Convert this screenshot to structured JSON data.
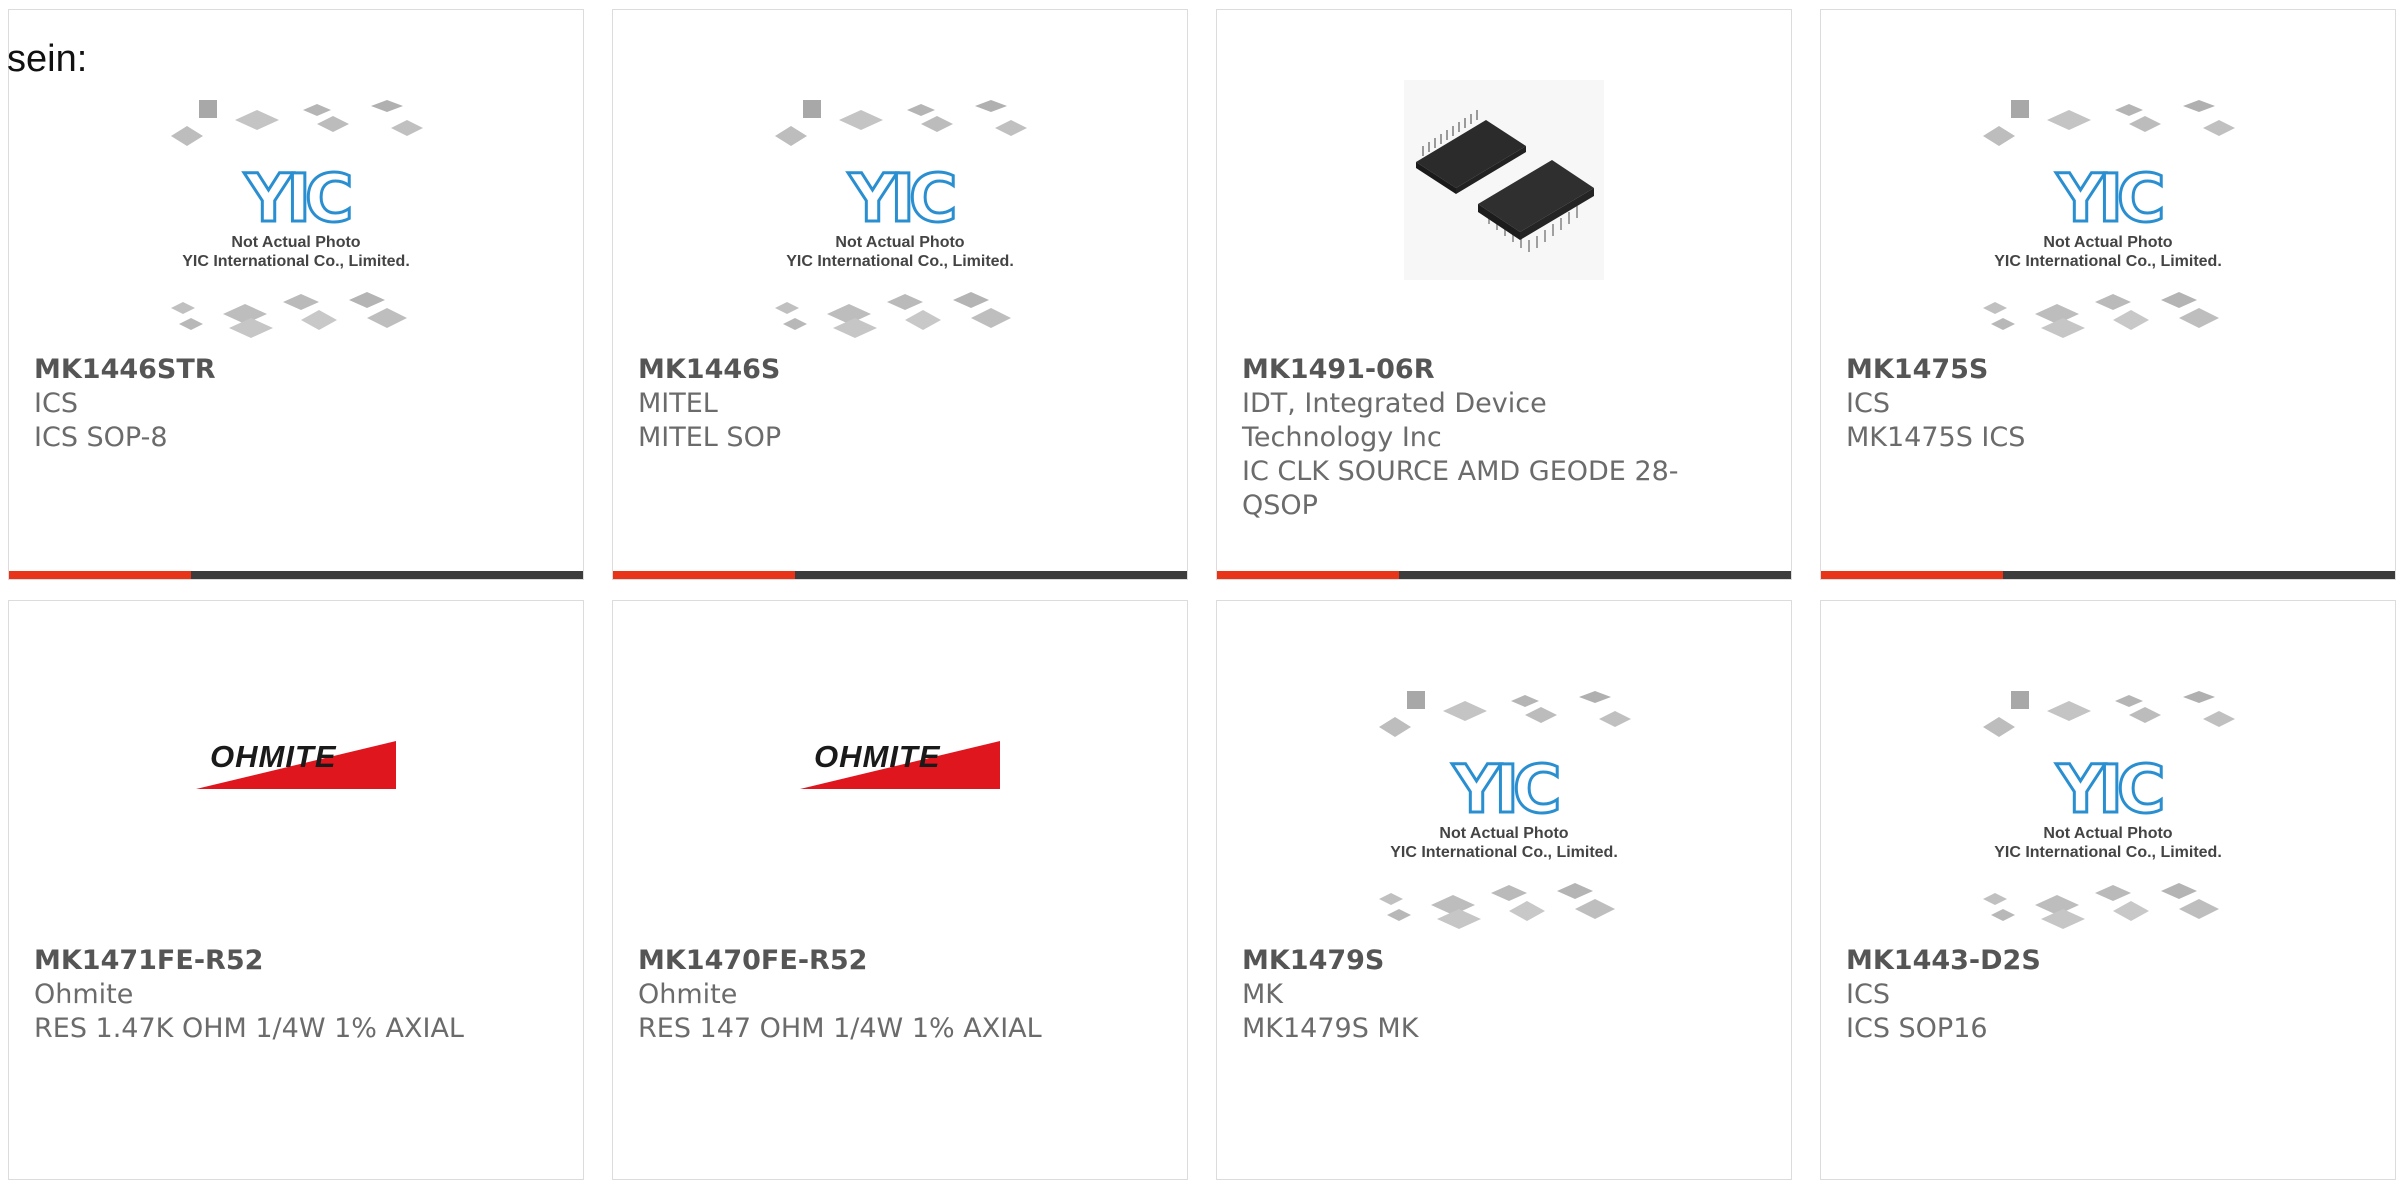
{
  "page": {
    "fragment_text": "sein:"
  },
  "colors": {
    "accent": "#e8351a",
    "bar": "#3c3c3c",
    "yic_blue": "#2a8fd0",
    "ohmite_red": "#e0161f"
  },
  "placeholder": {
    "line1": "Not Actual Photo",
    "line2": "YIC International Co., Limited.",
    "logo": "YIC"
  },
  "ohmite_logo": {
    "text": "OHMITE"
  },
  "products": [
    {
      "part": "MK1446STR",
      "manufacturer": "ICS",
      "description": "ICS SOP-8",
      "image": "yic-placeholder"
    },
    {
      "part": "MK1446S",
      "manufacturer": "MITEL",
      "description": "MITEL SOP",
      "image": "yic-placeholder"
    },
    {
      "part": "MK1491-06R",
      "manufacturer": "IDT, Integrated Device Technology Inc",
      "description": "IC CLK SOURCE AMD GEODE 28-QSOP",
      "image": "ic-photo"
    },
    {
      "part": "MK1475S",
      "manufacturer": "ICS",
      "description": "MK1475S ICS",
      "image": "yic-placeholder"
    },
    {
      "part": "MK1471FE-R52",
      "manufacturer": "Ohmite",
      "description": "RES 1.47K OHM 1/4W 1% AXIAL",
      "image": "ohmite-logo"
    },
    {
      "part": "MK1470FE-R52",
      "manufacturer": "Ohmite",
      "description": "RES 147 OHM 1/4W 1% AXIAL",
      "image": "ohmite-logo"
    },
    {
      "part": "MK1479S",
      "manufacturer": "MK",
      "description": "MK1479S MK",
      "image": "yic-placeholder"
    },
    {
      "part": "MK1443-D2S",
      "manufacturer": "ICS",
      "description": "ICS SOP16",
      "image": "yic-placeholder"
    }
  ]
}
